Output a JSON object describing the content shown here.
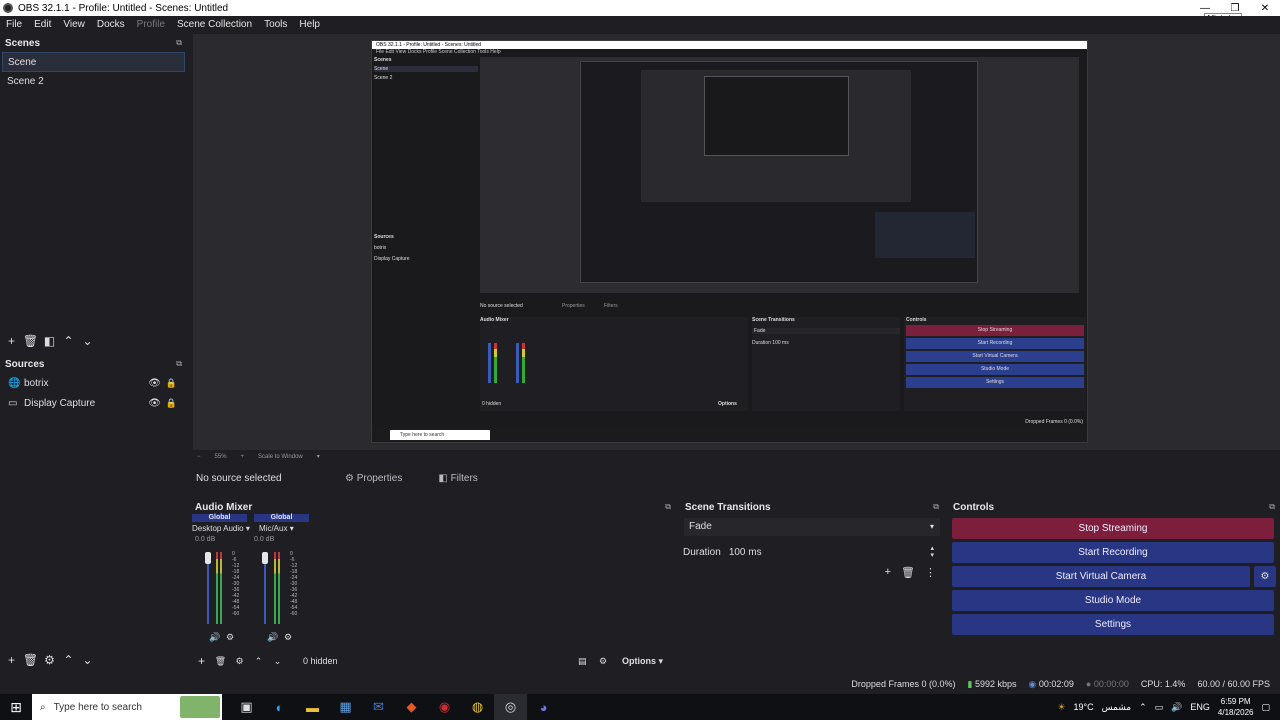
{
  "window": {
    "title": "OBS 32.1.1 - Profile: Untitled - Scenes: Untitled",
    "tooltip": "Minimize",
    "btn_min": "—",
    "btn_max": "❐",
    "btn_close": "✕"
  },
  "menu": {
    "file": "File",
    "edit": "Edit",
    "view": "View",
    "docks": "Docks",
    "profile": "Profile",
    "scene_collection": "Scene Collection",
    "tools": "Tools",
    "help": "Help"
  },
  "scenes": {
    "title": "Scenes",
    "items": [
      "Scene",
      "Scene 2"
    ]
  },
  "sources": {
    "title": "Sources",
    "items": [
      "botrix",
      "Display Capture"
    ]
  },
  "nested": {
    "title": "OBS 32.1.1 - Profile: Untitled - Scenes: Untitled",
    "menu": "File  Edit  View  Docks  Profile  Scene Collection  Tools  Help",
    "scenes": "Scenes",
    "scene1": "Scene",
    "scene2": "Scene 2",
    "sources": "Sources",
    "src1": "botrix",
    "src2": "Display Capture",
    "no_source": "No source selected",
    "properties": "Properties",
    "filters": "Filters",
    "audio_mixer": "Audio Mixer",
    "scene_transitions": "Scene Transitions",
    "controls": "Controls",
    "fade": "Fade",
    "duration": "Duration",
    "duration_val": "100 ms",
    "stop_streaming": "Stop Streaming",
    "start_recording": "Start Recording",
    "start_virtual_camera": "Start Virtual Camera",
    "studio_mode": "Studio Mode",
    "settings": "Settings",
    "hidden": "0 hidden",
    "options": "Options",
    "status": "Dropped Frames 0 (0.0%)",
    "search": "Type here to search"
  },
  "zoom": {
    "minus": "−",
    "value": "55%",
    "plus": "+",
    "scale": "Scale to Window"
  },
  "source_bar": {
    "no_source": "No source selected",
    "properties": "Properties",
    "filters": "Filters"
  },
  "mixer": {
    "title": "Audio Mixer",
    "channels": [
      {
        "global": "Global",
        "name": "Desktop Audio",
        "db": "0.0 dB"
      },
      {
        "global": "Global",
        "name": "Mic/Aux",
        "db": "0.0 dB"
      }
    ],
    "ticks": [
      "0",
      "-6",
      "-12",
      "-18",
      "-24",
      "-30",
      "-36",
      "-42",
      "-48",
      "-54",
      "-60"
    ],
    "hidden": "0 hidden",
    "options": "Options"
  },
  "transitions": {
    "title": "Scene Transitions",
    "selected": "Fade",
    "duration_label": "Duration",
    "duration_value": "100 ms"
  },
  "controls": {
    "title": "Controls",
    "stop_streaming": "Stop Streaming",
    "start_recording": "Start Recording",
    "start_virtual_camera": "Start Virtual Camera",
    "studio_mode": "Studio Mode",
    "settings": "Settings"
  },
  "status": {
    "dropped": "Dropped Frames 0 (0.0%)",
    "bitrate": "5992 kbps",
    "stream_time": "00:02:09",
    "rec_time": "00:00:00",
    "cpu": "CPU: 1.4%",
    "fps": "60.00 / 60.00 FPS"
  },
  "taskbar": {
    "search_placeholder": "Type here to search",
    "weather": "19°C",
    "weather_desc": "مشمس",
    "lang": "ENG",
    "time": "6:59 PM",
    "date": "4/18/2026"
  },
  "colors": {
    "accent_blue": "#283684",
    "stream_red": "#7c1e3c",
    "panel_bg": "#1f1f23"
  }
}
